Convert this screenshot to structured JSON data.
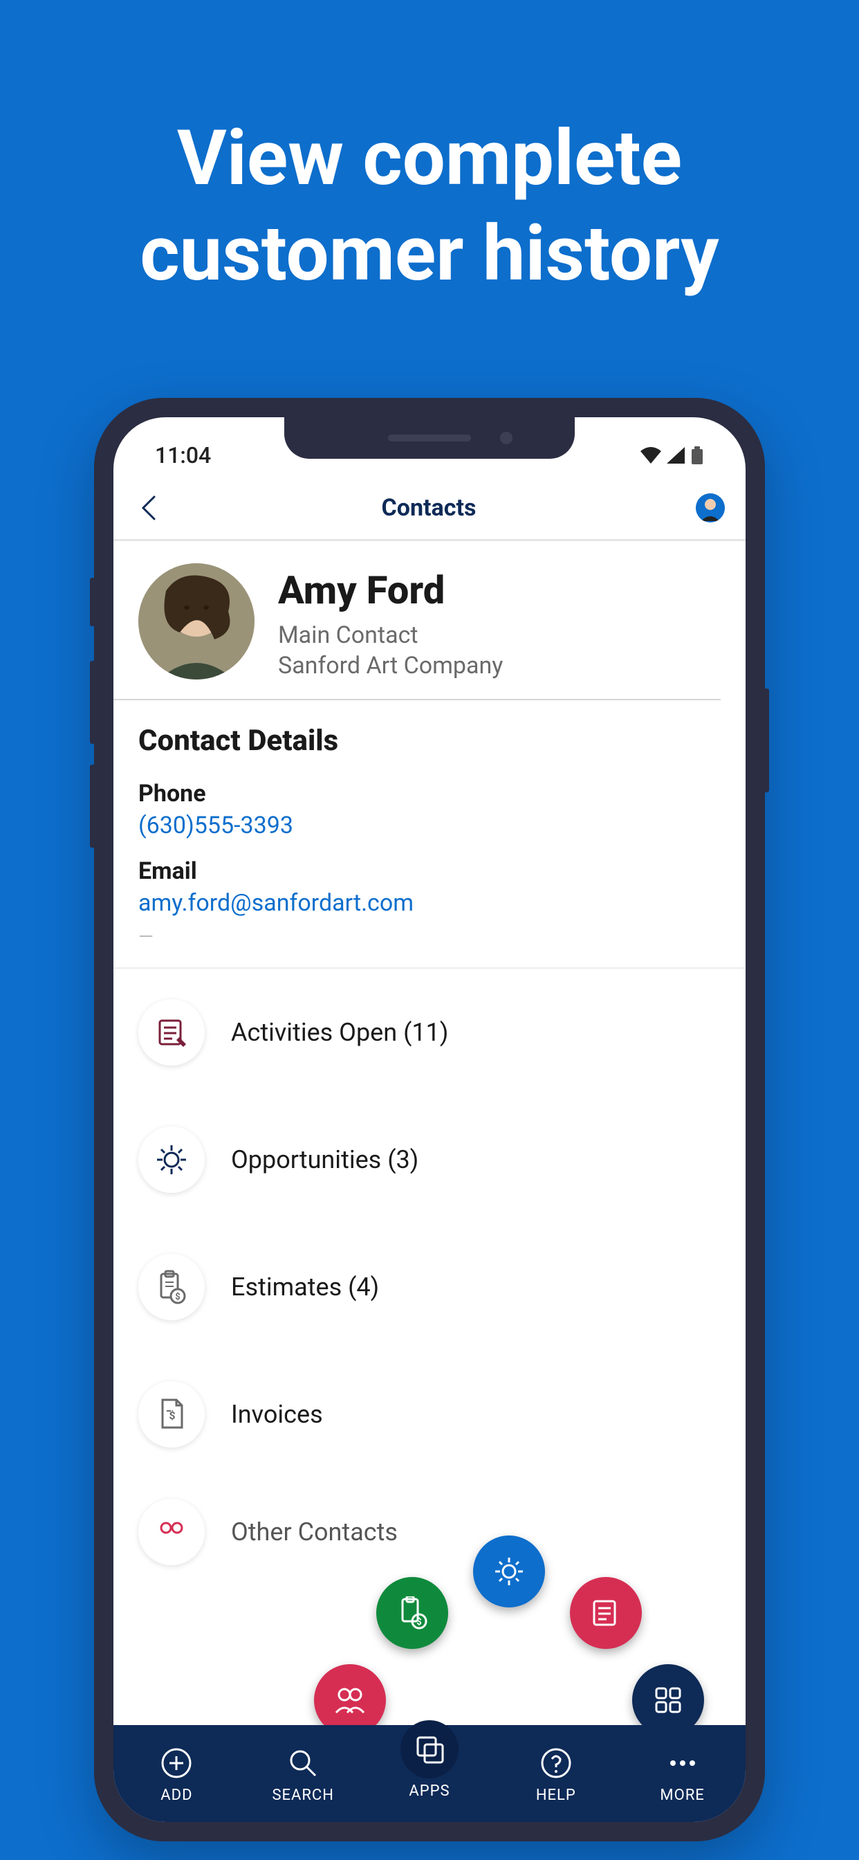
{
  "hero": {
    "line1": "View complete",
    "line2": "customer history"
  },
  "status": {
    "time": "11:04"
  },
  "header": {
    "title": "Contacts"
  },
  "contact": {
    "name": "Amy Ford",
    "role": "Main Contact",
    "company": "Sanford Art Company"
  },
  "details": {
    "section_title": "Contact Details",
    "phone_label": "Phone",
    "phone_value": "(630)555-3393",
    "email_label": "Email",
    "email_value": "amy.ford@sanfordart.com"
  },
  "rows": {
    "activities": "Activities Open (11)",
    "opportunities": "Opportunities (3)",
    "estimates": "Estimates (4)",
    "invoices": "Invoices",
    "other_contacts": "Other Contacts"
  },
  "nav": {
    "add": "ADD",
    "search": "SEARCH",
    "apps": "APPS",
    "help": "HELP",
    "more": "MORE"
  },
  "colors": {
    "fab_green": "#0f8a3c",
    "fab_blue": "#0d6ecc",
    "fab_red": "#d62e53",
    "fab_navy": "#0e2a57"
  }
}
